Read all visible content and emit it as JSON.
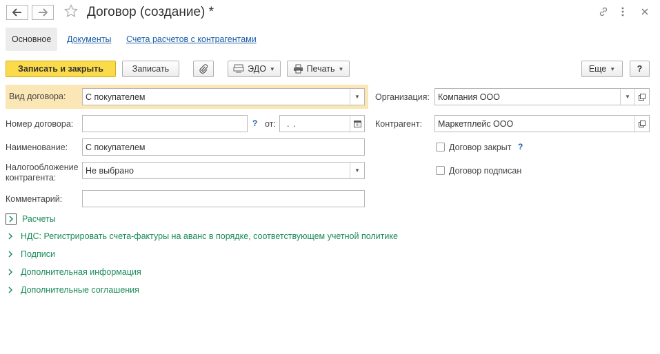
{
  "window": {
    "title": "Договор (создание) *",
    "back_icon": "arrow-left-icon",
    "forward_icon": "arrow-right-icon"
  },
  "tabs": [
    {
      "label": "Основное"
    },
    {
      "label": "Документы"
    },
    {
      "label": "Счета расчетов с контрагентами"
    }
  ],
  "toolbar": {
    "save_close_label": "Записать и закрыть",
    "save_label": "Записать",
    "edo_label": "ЭДО",
    "print_label": "Печать",
    "more_label": "Еще",
    "help_label": "?"
  },
  "form": {
    "contract_type": {
      "label": "Вид договора:",
      "value": "С покупателем"
    },
    "number": {
      "label": "Номер договора:",
      "value": "",
      "help": "?",
      "date_label": "от:",
      "date_value": " .  . "
    },
    "name": {
      "label": "Наименование:",
      "value": "С покупателем"
    },
    "taxation": {
      "label_line1": "Налогообложение",
      "label_line2": "контрагента:",
      "value": "Не выбрано"
    },
    "comment": {
      "label": "Комментарий:",
      "value": ""
    },
    "organization": {
      "label": "Организация:",
      "value": "Компания ООО"
    },
    "counterparty": {
      "label": "Контрагент:",
      "value": "Маркетплейс ООО"
    },
    "closed": {
      "label": "Договор закрыт",
      "help": "?"
    },
    "signed": {
      "label": "Договор подписан"
    }
  },
  "sections": [
    {
      "label": "Расчеты"
    },
    {
      "label": "НДС: Регистрировать счета-фактуры на аванс в порядке, соответствующем учетной политике"
    },
    {
      "label": "Подписи"
    },
    {
      "label": "Дополнительная информация"
    },
    {
      "label": "Дополнительные соглашения"
    }
  ],
  "colors": {
    "accent_yellow": "#fbdb4a",
    "highlight_row": "#fbe7b5",
    "link_blue": "#1a5ca8",
    "section_green": "#1a8a5a"
  }
}
